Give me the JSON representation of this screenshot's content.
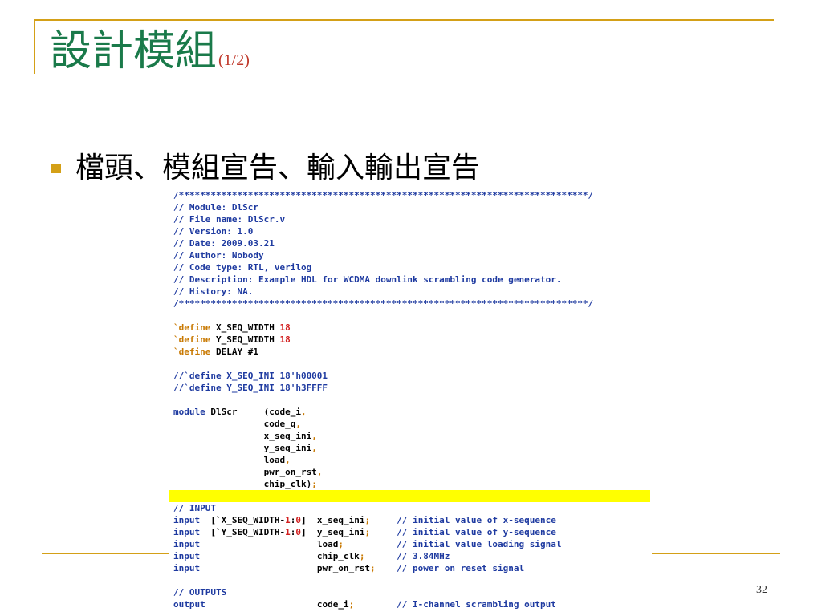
{
  "slide": {
    "title": "設計模組",
    "title_suffix": "(1/2)",
    "bullet_text": "檔頭、模組宣告、輸入輸出宣告",
    "page_number": "32"
  },
  "colors": {
    "title_green": "#1a7a4a",
    "title_suffix_red": "#c0392b",
    "accent_gold": "#d4a017",
    "highlight_yellow": "#ffff00",
    "code_blue": "#1e3aa0",
    "code_orange": "#c87800",
    "code_red": "#d21f1f"
  },
  "code_lines": [
    [
      [
        "comment",
        "/*****************************************************************************/"
      ]
    ],
    [
      [
        "comment",
        "// Module: DlScr"
      ]
    ],
    [
      [
        "comment",
        "// File name: DlScr.v"
      ]
    ],
    [
      [
        "comment",
        "// Version: 1.0"
      ]
    ],
    [
      [
        "comment",
        "// Date: 2009.03.21"
      ]
    ],
    [
      [
        "comment",
        "// Author: Nobody"
      ]
    ],
    [
      [
        "comment",
        "// Code type: RTL, verilog"
      ]
    ],
    [
      [
        "comment",
        "// Description: Example HDL for WCDMA downlink scrambling code generator."
      ]
    ],
    [
      [
        "comment",
        "// History: NA."
      ]
    ],
    [
      [
        "comment",
        "/*****************************************************************************/"
      ]
    ],
    [],
    [
      [
        "dir",
        "`define"
      ],
      [
        "plain",
        " X_SEQ_WIDTH "
      ],
      [
        "num",
        "18"
      ]
    ],
    [
      [
        "dir",
        "`define"
      ],
      [
        "plain",
        " Y_SEQ_WIDTH "
      ],
      [
        "num",
        "18"
      ]
    ],
    [
      [
        "dir",
        "`define"
      ],
      [
        "plain",
        " DELAY #1"
      ]
    ],
    [],
    [
      [
        "comment",
        "//`define X_SEQ_INI 18'h00001"
      ]
    ],
    [
      [
        "comment",
        "//`define Y_SEQ_INI 18'h3FFFF"
      ]
    ],
    [],
    [
      [
        "kw",
        "module"
      ],
      [
        "plain",
        " DlScr     (code_i"
      ],
      [
        "punct",
        ","
      ]
    ],
    [
      [
        "plain",
        "                 code_q"
      ],
      [
        "punct",
        ","
      ]
    ],
    [
      [
        "plain",
        "                 x_seq_ini"
      ],
      [
        "punct",
        ","
      ]
    ],
    [
      [
        "plain",
        "                 y_seq_ini"
      ],
      [
        "punct",
        ","
      ]
    ],
    [
      [
        "plain",
        "                 load"
      ],
      [
        "punct",
        ","
      ]
    ],
    [
      [
        "plain",
        "                 pwr_on_rst"
      ],
      [
        "punct",
        ","
      ]
    ],
    [
      [
        "plain",
        "                 chip_clk)"
      ],
      [
        "punct",
        ";"
      ]
    ],
    [],
    [
      [
        "comment",
        "// INPUT"
      ]
    ],
    [
      [
        "kw",
        "input"
      ],
      [
        "plain",
        "  [`X_SEQ_WIDTH-"
      ],
      [
        "num",
        "1"
      ],
      [
        "plain",
        ":"
      ],
      [
        "num",
        "0"
      ],
      [
        "plain",
        "]  x_seq_ini"
      ],
      [
        "punct",
        ";"
      ],
      [
        "plain",
        "     "
      ],
      [
        "comment",
        "// initial value of x-sequence"
      ]
    ],
    [
      [
        "kw",
        "input"
      ],
      [
        "plain",
        "  [`Y_SEQ_WIDTH-"
      ],
      [
        "num",
        "1"
      ],
      [
        "plain",
        ":"
      ],
      [
        "num",
        "0"
      ],
      [
        "plain",
        "]  y_seq_ini"
      ],
      [
        "punct",
        ";"
      ],
      [
        "plain",
        "     "
      ],
      [
        "comment",
        "// initial value of y-sequence"
      ]
    ],
    [
      [
        "kw",
        "input"
      ],
      [
        "plain",
        "                      load"
      ],
      [
        "punct",
        ";"
      ],
      [
        "plain",
        "          "
      ],
      [
        "comment",
        "// initial value loading signal"
      ]
    ],
    [
      [
        "kw",
        "input"
      ],
      [
        "plain",
        "                      chip_clk"
      ],
      [
        "punct",
        ";"
      ],
      [
        "plain",
        "      "
      ],
      [
        "comment",
        "// 3.84MHz"
      ]
    ],
    [
      [
        "kw",
        "input"
      ],
      [
        "plain",
        "                      pwr_on_rst"
      ],
      [
        "punct",
        ";"
      ],
      [
        "plain",
        "    "
      ],
      [
        "comment",
        "// power on reset signal"
      ]
    ],
    [],
    [
      [
        "comment",
        "// OUTPUTS"
      ]
    ],
    [
      [
        "kw",
        "output"
      ],
      [
        "plain",
        "                     code_i"
      ],
      [
        "punct",
        ";"
      ],
      [
        "plain",
        "        "
      ],
      [
        "comment",
        "// I-channel scrambling output"
      ]
    ]
  ]
}
